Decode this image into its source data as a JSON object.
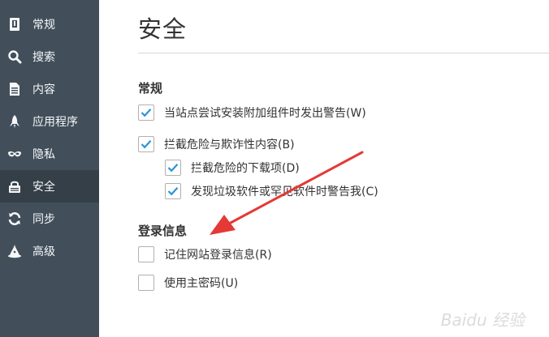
{
  "sidebar": {
    "items": [
      {
        "label": "常规",
        "icon": "general-icon"
      },
      {
        "label": "搜索",
        "icon": "search-icon"
      },
      {
        "label": "内容",
        "icon": "document-icon"
      },
      {
        "label": "应用程序",
        "icon": "rocket-icon"
      },
      {
        "label": "隐私",
        "icon": "mask-icon"
      },
      {
        "label": "安全",
        "icon": "lock-icon",
        "active": true
      },
      {
        "label": "同步",
        "icon": "sync-icon"
      },
      {
        "label": "高级",
        "icon": "wizard-hat-icon"
      }
    ]
  },
  "main": {
    "title": "安全",
    "general": {
      "heading": "常规",
      "warn_addons": {
        "label": "当站点尝试安装附加组件时发出警告(W)",
        "checked": true
      },
      "block_dangerous": {
        "label": "拦截危险与欺诈性内容(B)",
        "checked": true
      },
      "block_downloads": {
        "label": "拦截危险的下载项(D)",
        "checked": true
      },
      "warn_unwanted": {
        "label": "发现垃圾软件或罕见软件时警告我(C)",
        "checked": true
      }
    },
    "logins": {
      "heading": "登录信息",
      "remember_logins": {
        "label": "记住网站登录信息(R)",
        "checked": false
      },
      "master_password": {
        "label": "使用主密码(U)",
        "checked": false
      }
    }
  },
  "colors": {
    "sidebar_bg": "#424f5a",
    "sidebar_active": "#343f48",
    "check_color": "#2b95d6",
    "arrow_color": "#e53935"
  },
  "watermark": "Baidu 经验"
}
